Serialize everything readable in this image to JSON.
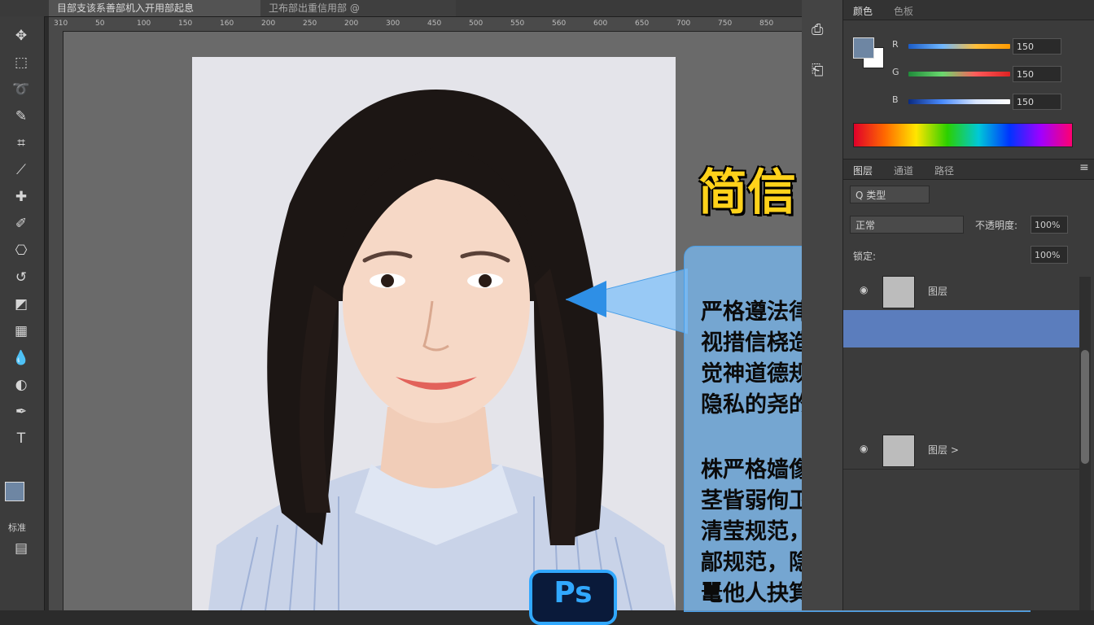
{
  "tabs": {
    "doc_a": "目部支该系善部机入开用部起息",
    "doc_b": "卫布部出重信用部 @"
  },
  "ruler_ticks": [
    "310",
    "50",
    "100",
    "150",
    "160",
    "200",
    "250",
    "200",
    "300",
    "450",
    "500",
    "550",
    "560",
    "600",
    "650",
    "700",
    "750",
    "850"
  ],
  "panels": {
    "color_tab": "颜色",
    "swatch_tab": "色板",
    "layers_tab": "图层",
    "channels_tab": "通道",
    "paths_tab": "路径",
    "kind_filter": "Q 类型",
    "blend_mode": "正常",
    "opacity_label": "不透明度:",
    "opacity_value": "100%",
    "lock_label": "锁定:",
    "fill_value": "100%",
    "layer_1": "图层",
    "layer_2": "图层 >"
  },
  "sliders": [
    {
      "label": "R",
      "value": "150",
      "gradient": "linear-gradient(90deg,#1a5cc8,#6fb7ff,#ffbf3a,#ff9a00)"
    },
    {
      "label": "G",
      "value": "150",
      "gradient": "linear-gradient(90deg,#1f8a3a,#6ad96e,#ff5a5a,#d22)"
    },
    {
      "label": "B",
      "value": "150",
      "gradient": "linear-gradient(90deg,#0a2a80,#4a8cff,#d9e6ff,#ffffff)"
    }
  ],
  "colors": {
    "foreground": "#6e86a3",
    "background": "#ffffff",
    "headline": "#ffd21a",
    "callout": "#7abefa",
    "ps_blue": "#31a8ff"
  },
  "overlay": {
    "headline": "简信",
    "para1": [
      "严格遵法律法规分规，讨",
      "视措信桡造律龍仪练宾槭",
      "觉神道德规范，捞執丁人",
      "隐私的尧的医尊重護护患。"
    ],
    "para2": [
      "株严格嫱像道睥规范，程",
      "茎眥弱侚卫鲤梼润的矮定",
      "清莹规范，尊重他人人昕",
      "鄗规范，隐祉私、瞽北篠",
      "鼍他人抉箕龌辩"
    ],
    "ps_badge": "Ps"
  },
  "toolbar_icons": [
    "move-icon",
    "marquee-icon",
    "lasso-icon",
    "quick-select-icon",
    "crop-icon",
    "eyedropper-icon",
    "healing-brush-icon",
    "brush-icon",
    "clone-stamp-icon",
    "history-brush-icon",
    "eraser-icon",
    "gradient-icon",
    "blur-icon",
    "dodge-icon",
    "pen-icon",
    "text-icon"
  ],
  "toolbar_labels": {
    "bottom": "标准"
  }
}
